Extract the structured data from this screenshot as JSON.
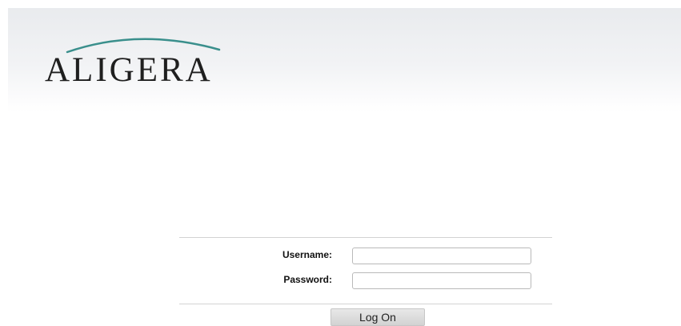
{
  "brand": {
    "logo_text": "ALIGERA",
    "arc_color": "#3a8f8c"
  },
  "login": {
    "username_label": "Username:",
    "username_value": "",
    "password_label": "Password:",
    "password_value": "",
    "submit_label": "Log On"
  }
}
